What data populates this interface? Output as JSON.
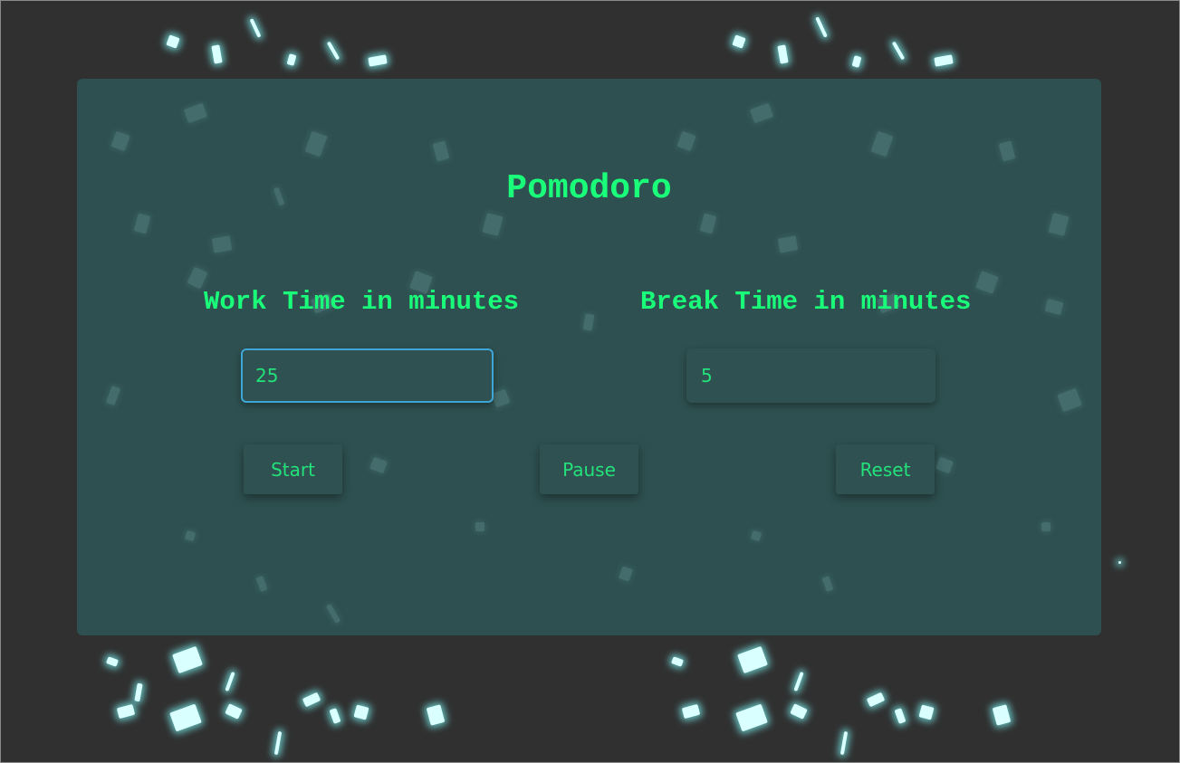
{
  "app": {
    "title": "Pomodoro"
  },
  "work": {
    "label": "Work Time in minutes",
    "value": "25"
  },
  "break": {
    "label": "Break Time in minutes",
    "value": "5"
  },
  "buttons": {
    "start_label": "Start",
    "pause_label": "Pause",
    "reset_label": "Reset"
  },
  "colors": {
    "background": "#303030",
    "panel": "#2e5050",
    "accent_text": "#1aff7a",
    "focus_border": "#3ea6d6"
  }
}
